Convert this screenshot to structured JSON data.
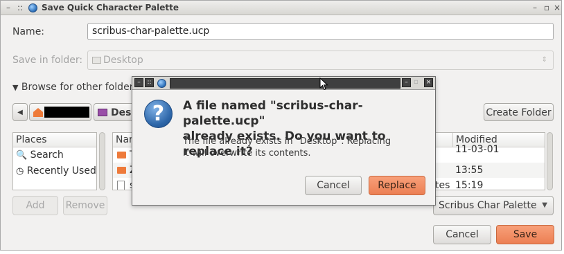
{
  "window": {
    "title": "Save Quick Character Palette"
  },
  "form": {
    "name_label": "Name:",
    "name_value": "scribus-char-palette.ucp",
    "folder_label": "Save in folder:",
    "folder_value": "Desktop",
    "browse_label": "Browse for other folders"
  },
  "pathbar": {
    "segment_label": "Desk"
  },
  "create_folder_label": "Create Folder",
  "places": {
    "header": "Places",
    "items": [
      {
        "label": "Search",
        "icon": "search-icon"
      },
      {
        "label": "Recently Used",
        "icon": "clock-icon"
      }
    ]
  },
  "files": {
    "name_header": "Nar",
    "modified_header": "Modified",
    "rows": [
      {
        "name": "T",
        "size_frag": "",
        "modified": "11-03-01",
        "icon": "folder-icon"
      },
      {
        "name": "Z",
        "size_frag": "",
        "modified": "13:55",
        "icon": "folder-icon"
      },
      {
        "name": "s",
        "size_frag": "tes",
        "modified": "15:19",
        "icon": "file-icon"
      }
    ]
  },
  "add_label": "Add",
  "remove_label": "Remove",
  "filter_value": "Scribus Char Palette",
  "cancel_label": "Cancel",
  "save_label": "Save",
  "dialog": {
    "primary_line1": "A file named \"scribus-char-palette.ucp\"",
    "primary_line2": "already exists.  Do you want to replace it?",
    "secondary_line1": "The file already exists in \"Desktop\".  Replacing",
    "secondary_line2": "it will overwrite its contents.",
    "cancel_label": "Cancel",
    "replace_label": "Replace"
  },
  "colors": {
    "accent": "#ec7f53",
    "window_bg": "#f2f1f0",
    "dialog_titlebar": "#3f3f3f"
  }
}
